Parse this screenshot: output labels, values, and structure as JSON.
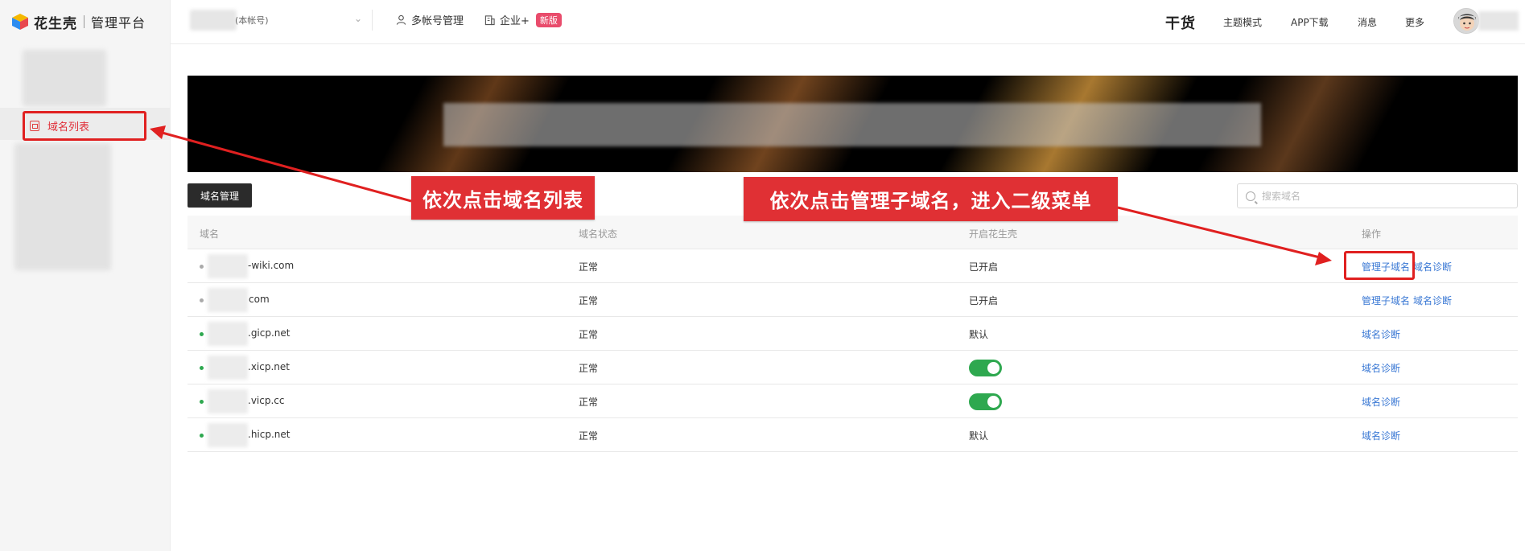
{
  "app": {
    "brand": "花生壳",
    "subtitle": "管理平台"
  },
  "sidebar": {
    "active_item": "域名列表"
  },
  "topbar": {
    "account_suffix": "(本帐号)",
    "multi_account": "多帐号管理",
    "enterprise": "企业+",
    "new_badge": "新版",
    "ganhuo": "干货",
    "theme": "主题模式",
    "app_download": "APP下载",
    "messages": "消息",
    "more": "更多"
  },
  "toolbar": {
    "manage_button": "域名管理",
    "search_placeholder": "搜索域名"
  },
  "table": {
    "headers": [
      "域名",
      "域名状态",
      "开启花生壳",
      "操作"
    ],
    "rows": [
      {
        "domain": "-wiki.com",
        "status": "正常",
        "enabled": "已开启",
        "toggle": false,
        "dot_color": "#aaaaaa",
        "ops": [
          "管理子域名",
          "域名诊断"
        ]
      },
      {
        "domain": "com",
        "status": "正常",
        "enabled": "已开启",
        "toggle": false,
        "dot_color": "#aaaaaa",
        "ops": [
          "管理子域名",
          "域名诊断"
        ]
      },
      {
        "domain": ".gicp.net",
        "status": "正常",
        "enabled": "默认",
        "toggle": false,
        "dot_color": "#2ea84f",
        "ops": [
          "域名诊断"
        ]
      },
      {
        "domain": ".xicp.net",
        "status": "正常",
        "enabled": "",
        "toggle": true,
        "dot_color": "#2ea84f",
        "ops": [
          "域名诊断"
        ]
      },
      {
        "domain": ".vicp.cc",
        "status": "正常",
        "enabled": "",
        "toggle": true,
        "dot_color": "#2ea84f",
        "ops": [
          "域名诊断"
        ]
      },
      {
        "domain": ".hicp.net",
        "status": "正常",
        "enabled": "默认",
        "toggle": false,
        "dot_color": "#2ea84f",
        "ops": [
          "域名诊断"
        ]
      }
    ]
  },
  "annotations": {
    "left_callout": "依次点击域名列表",
    "right_callout": "依次点击管理子域名，进入二级菜单"
  },
  "colors": {
    "annotation_red": "#e02020",
    "link_blue": "#3a78d4",
    "toggle_green": "#2ea84f",
    "badge_pink": "#e94c6c"
  }
}
